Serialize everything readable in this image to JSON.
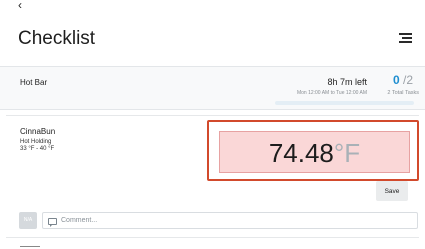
{
  "nav": {
    "back_icon": "chevron-left-icon",
    "menu_icon": "hamburger-menu-icon"
  },
  "page": {
    "title": "Checklist"
  },
  "header": {
    "section_name": "Hot Bar",
    "time_left": "8h 7m left",
    "time_range": "Mon 12:00 AM to Tue 12:00 AM",
    "completed": "0",
    "total": "/2",
    "total_label": "2 Total Tasks",
    "progress_fraction": 0.0,
    "accent_color": "#1e8ed0"
  },
  "task": {
    "name": "CinnaBun",
    "category": "Hot Holding",
    "range": "33 °F - 40 °F",
    "temperature_value": "74.48",
    "temperature_unit": "°F",
    "status_color": "#fad7d7",
    "save_label": "Save",
    "na_label": "N/A",
    "comment_placeholder": "Comment..."
  }
}
